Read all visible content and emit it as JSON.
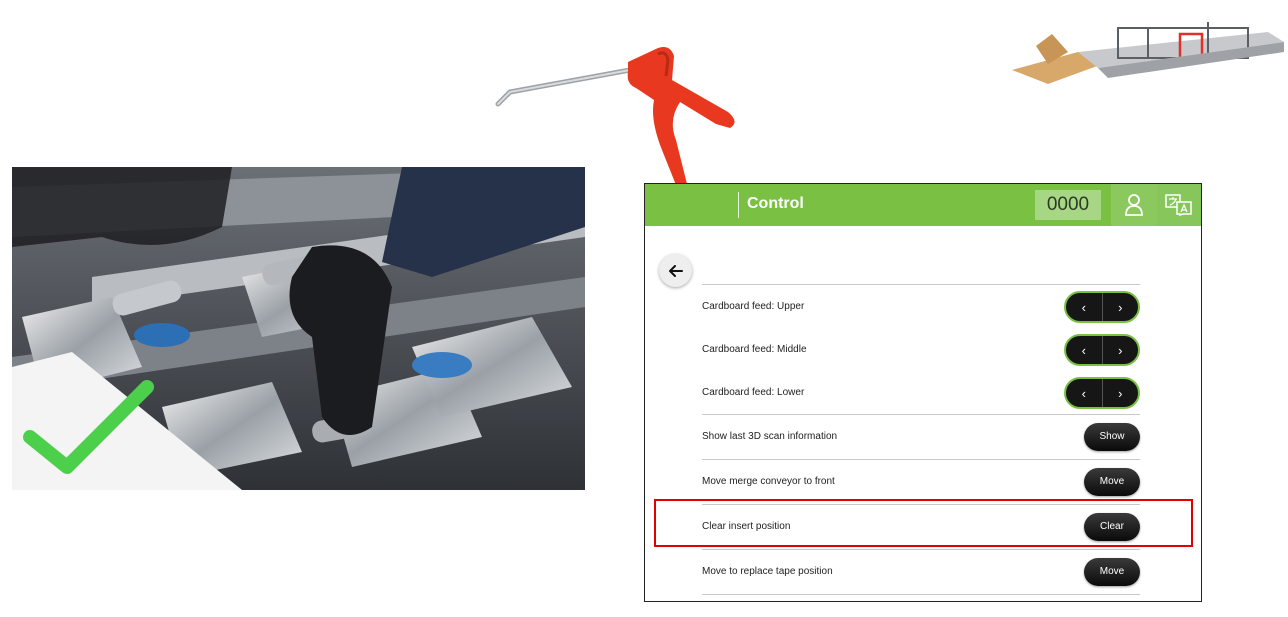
{
  "header": {
    "title": "Control",
    "counter": "0000",
    "user_icon": "user-icon",
    "language_icon": "translate-icon"
  },
  "back_icon": "arrow-left-icon",
  "rows": [
    {
      "label": "Cardboard feed: Upper",
      "control": "stepper",
      "prev": "‹",
      "next": "›"
    },
    {
      "label": "Cardboard feed: Middle",
      "control": "stepper",
      "prev": "‹",
      "next": "›"
    },
    {
      "label": "Cardboard feed: Lower",
      "control": "stepper",
      "prev": "‹",
      "next": "›"
    },
    {
      "label": "Show last 3D scan information",
      "control": "button",
      "button": "Show"
    },
    {
      "label": "Move merge conveyor to front",
      "control": "button",
      "button": "Move"
    },
    {
      "label": "Clear insert position",
      "control": "button",
      "button": "Clear",
      "highlighted": true
    },
    {
      "label": "Move to replace tape position",
      "control": "button",
      "button": "Move"
    }
  ],
  "colors": {
    "header_green": "#79c043",
    "counter_bg": "#a7d785",
    "highlight_red": "#e00000",
    "button_black": "#111111",
    "checkmark_green": "#4cd04c",
    "airgun_red": "#e8381f"
  },
  "illustrations": {
    "photo": "hand-cleaning-rollers-photo",
    "check": "checkmark-icon",
    "airgun": "air-blow-gun-illustration",
    "machine": "packaging-machine-thumbnail"
  }
}
